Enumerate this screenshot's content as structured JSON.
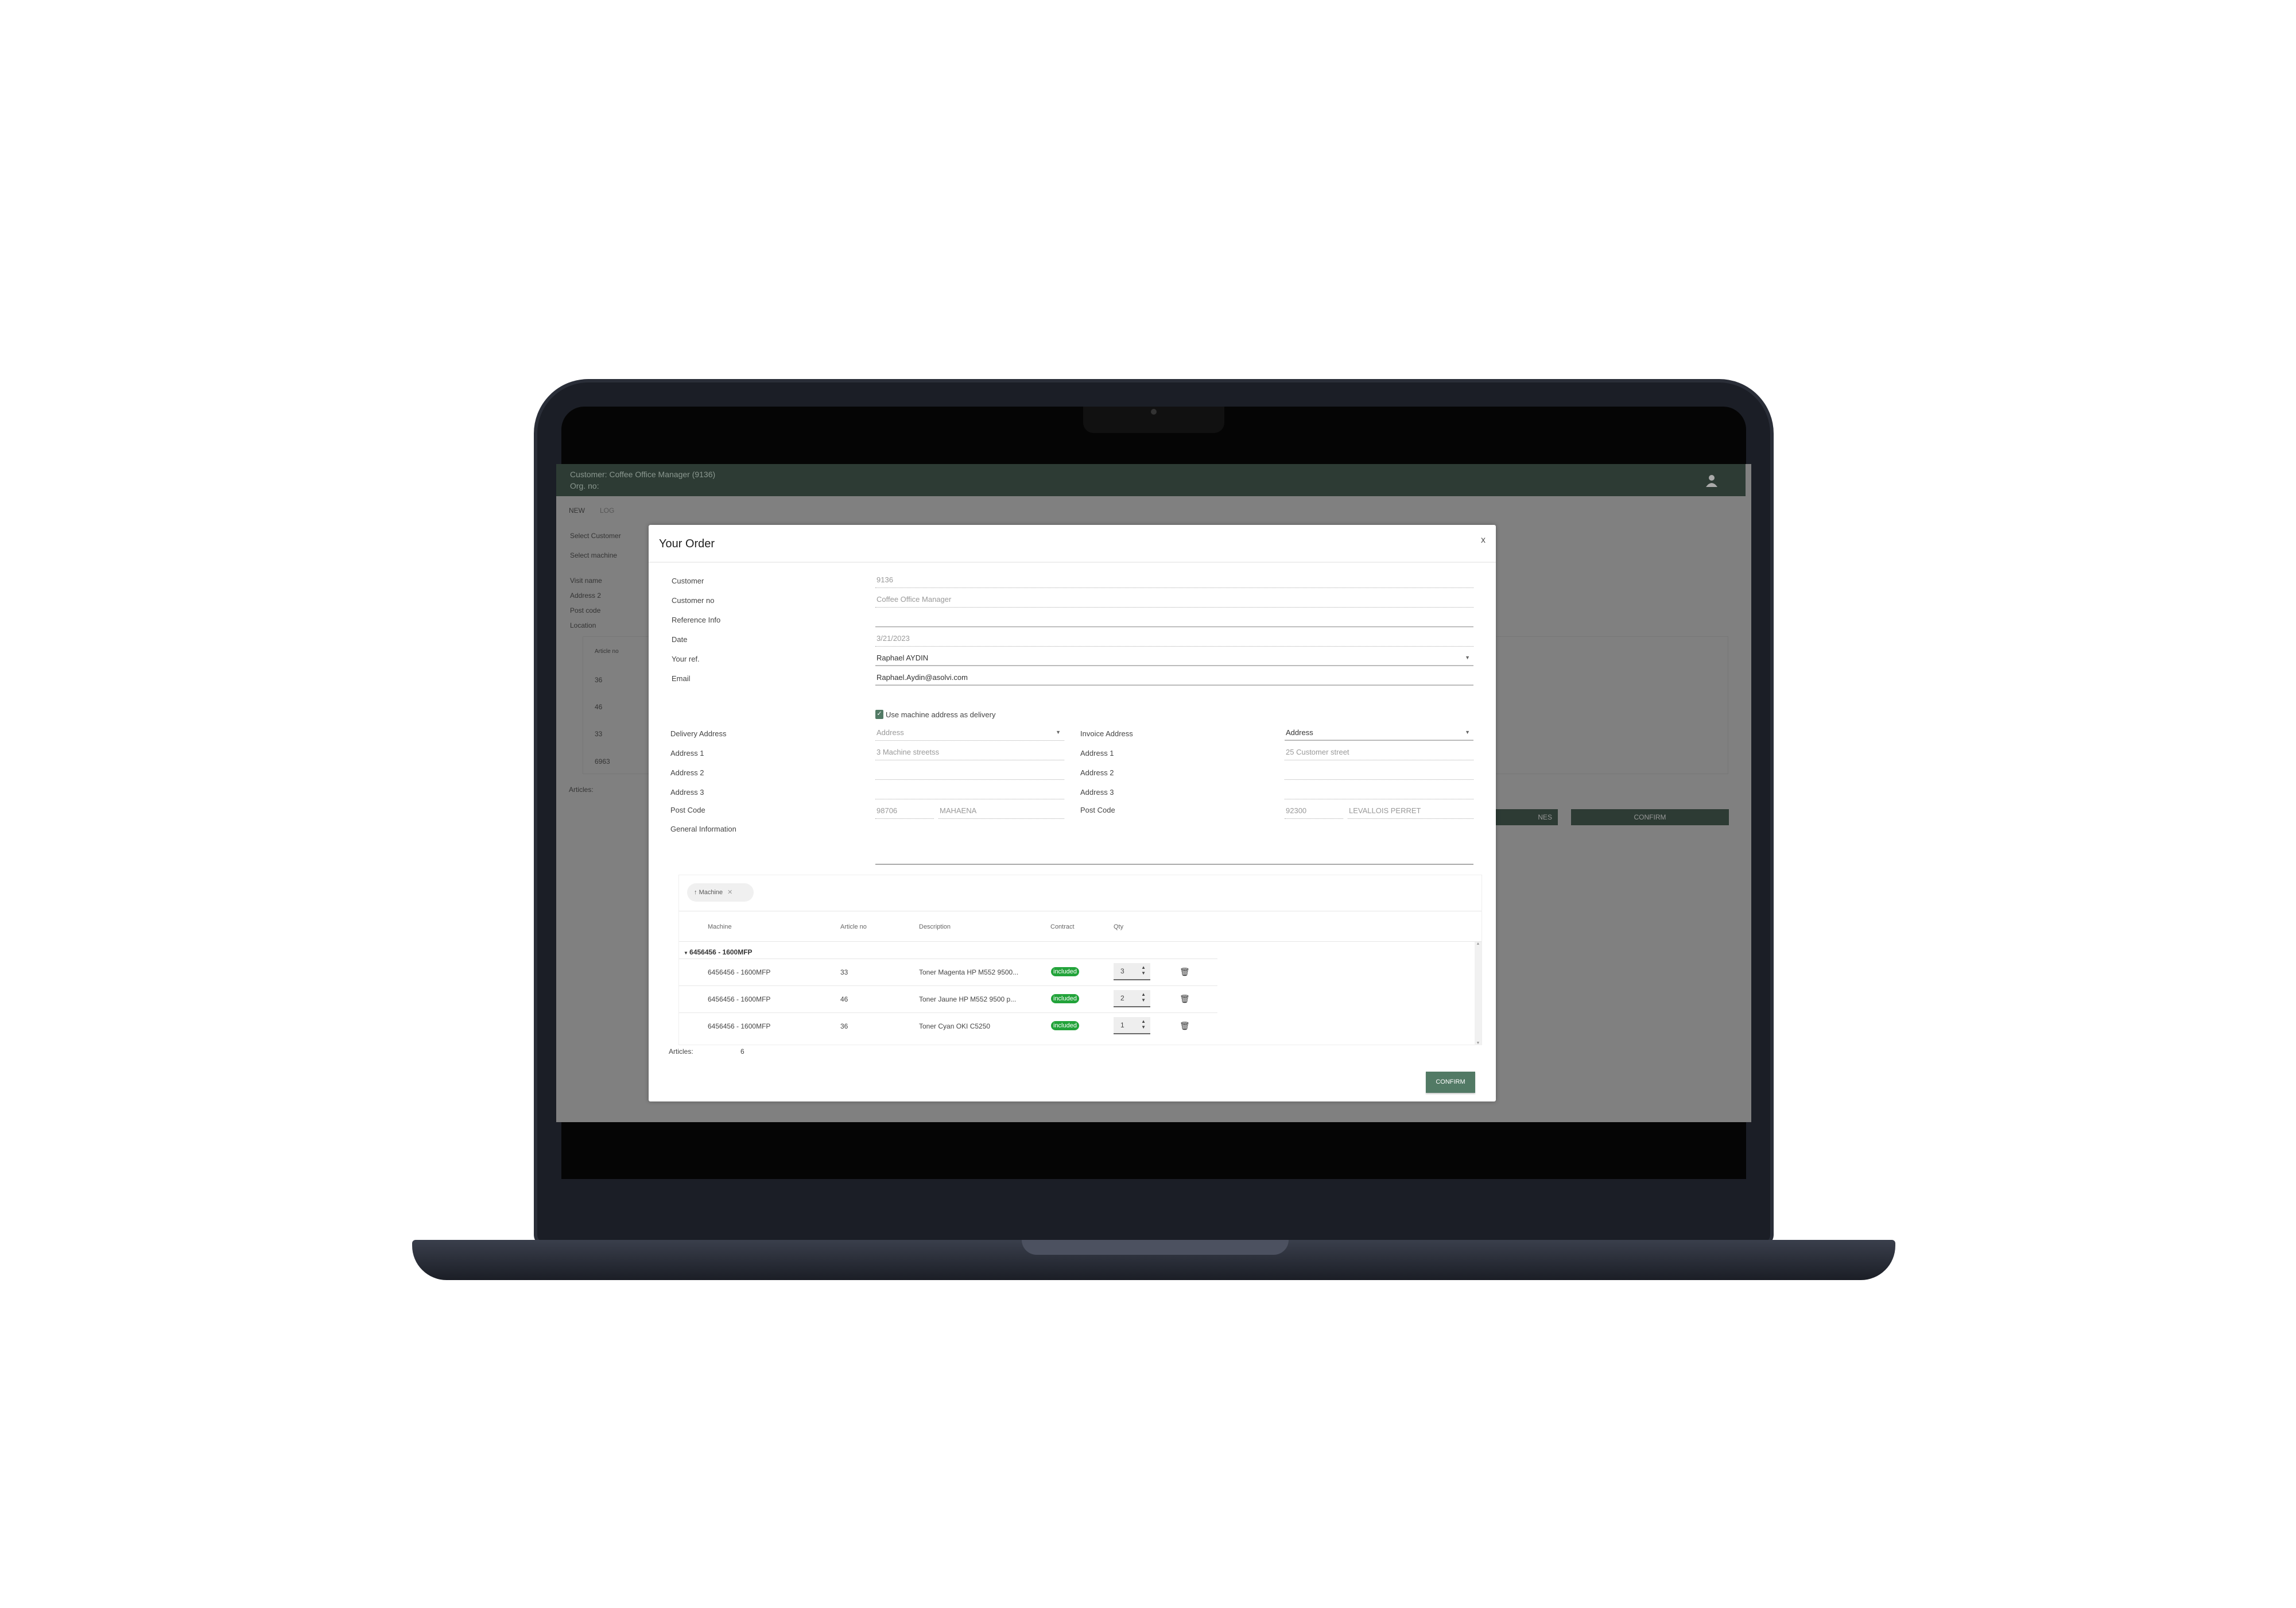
{
  "header": {
    "customer": "Customer: Coffee Office Manager (9136)",
    "org": "Org. no:"
  },
  "background": {
    "tabs": [
      "NEW",
      "LOG"
    ],
    "menu": [
      "Select Customer",
      "Select machine"
    ],
    "fields": [
      "Visit name",
      "Address 2",
      "Post code",
      "Location"
    ],
    "table_header": "Article no",
    "table_rows": [
      "36",
      "46",
      "33",
      "6963"
    ],
    "articles_label": "Articles:",
    "buttons": [
      "NES",
      "CONFIRM"
    ]
  },
  "modal": {
    "title": "Your Order",
    "close": "x",
    "fields": [
      {
        "label": "Customer",
        "value": "9136"
      },
      {
        "label": "Customer no",
        "value": "Coffee Office Manager"
      },
      {
        "label": "Reference Info",
        "value": ""
      },
      {
        "label": "Date",
        "value": "3/21/2023"
      },
      {
        "label": "Your ref.",
        "value": "Raphael AYDIN"
      },
      {
        "label": "Email",
        "value": "Raphael.Aydin@asolvi.com"
      }
    ],
    "checkbox": {
      "label": "Use machine address as delivery",
      "checked": true
    },
    "delivery": {
      "label": "Delivery Address",
      "select": "Address",
      "address1": "3 Machine streetss",
      "address2": "",
      "address3": "",
      "postcode": "98706",
      "city": "MAHAENA"
    },
    "invoice": {
      "label": "Invoice Address",
      "select": "Address",
      "address1": "25 Customer street",
      "address2": "",
      "address3": "",
      "postcode": "92300",
      "city": "LEVALLOIS PERRET"
    },
    "address_labels": [
      "Address 1",
      "Address 2",
      "Address 3",
      "Post Code"
    ],
    "general_info_label": "General Information",
    "grid": {
      "group_chip": "Machine",
      "columns": [
        "Machine",
        "Article no",
        "Description",
        "Contract",
        "Qty"
      ],
      "group": "6456456 - 1600MFP",
      "rows": [
        {
          "machine": "6456456 - 1600MFP",
          "article": "33",
          "description": "Toner Magenta HP M552 9500...",
          "contract": "included",
          "qty": "3"
        },
        {
          "machine": "6456456 - 1600MFP",
          "article": "46",
          "description": "Toner Jaune HP M552 9500 p...",
          "contract": "included",
          "qty": "2"
        },
        {
          "machine": "6456456 - 1600MFP",
          "article": "36",
          "description": "Toner Cyan OKI C5250",
          "contract": "included",
          "qty": "1"
        }
      ]
    },
    "articles_label": "Articles:",
    "articles_count": "6",
    "confirm": "CONFIRM"
  },
  "colors": {
    "brand": "#2d3b34",
    "button": "#527a65",
    "badge": "#22a33a"
  }
}
